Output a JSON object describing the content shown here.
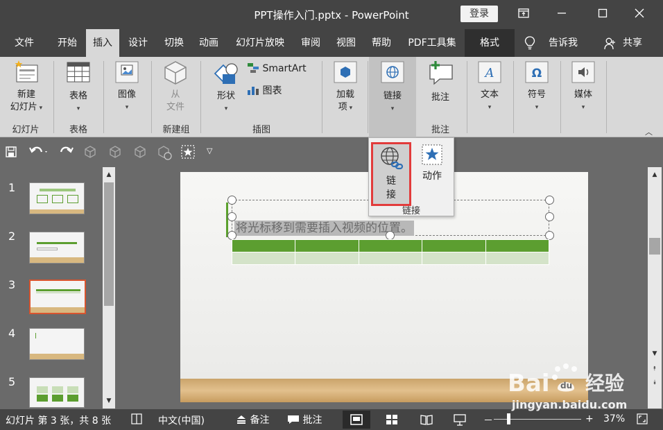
{
  "window": {
    "title": "PPT操作入门.pptx  -  PowerPoint",
    "login_label": "登录",
    "controls": [
      "ribbon-display-icon",
      "minimize-icon",
      "maximize-icon",
      "close-icon"
    ]
  },
  "tabs": [
    {
      "label": "文件"
    },
    {
      "label": "开始"
    },
    {
      "label": "插入"
    },
    {
      "label": "设计"
    },
    {
      "label": "切换"
    },
    {
      "label": "动画"
    },
    {
      "label": "幻灯片放映"
    },
    {
      "label": "审阅"
    },
    {
      "label": "视图"
    },
    {
      "label": "帮助"
    },
    {
      "label": "PDF工具集"
    },
    {
      "label": "格式"
    },
    {
      "label": "告诉我"
    },
    {
      "label": "共享"
    }
  ],
  "active_tab": "插入",
  "ribbon": {
    "new_slide": {
      "line1": "新建",
      "line2": "幻灯片"
    },
    "table": "表格",
    "image": "图像",
    "from": "从",
    "file": "文件",
    "shape": "形状",
    "smartart": "SmartArt",
    "chart": "图表",
    "addin": {
      "line1": "加载",
      "line2": "项"
    },
    "link": "链接",
    "comment": "批注",
    "text": "文本",
    "symbol": "符号",
    "media": "媒体",
    "groups": {
      "slides": "幻灯片",
      "tables": "表格",
      "new_group": "新建组",
      "illustrations": "插图",
      "comments": "批注"
    }
  },
  "link_popup": {
    "link": {
      "line1": "链",
      "line2": "接"
    },
    "action": "动作",
    "group_label": "链接"
  },
  "slides": [
    {
      "number": "1"
    },
    {
      "number": "2"
    },
    {
      "number": "3"
    },
    {
      "number": "4"
    },
    {
      "number": "5"
    }
  ],
  "current_slide": 3,
  "slide_content": {
    "text": "将光标移到需要插入视频的位置。"
  },
  "statusbar": {
    "slide_info": "幻灯片 第 3 张，共 8 张",
    "language": "中文(中国)",
    "notes": "备注",
    "comments": "批注",
    "zoom_minus": "－",
    "zoom_plus": "+",
    "zoom": "37%",
    "zoom_fraction": 0.37
  },
  "watermark": {
    "brand": "Bai",
    "brand2": "du",
    "suffix": "经验",
    "url": "jingyan.baidu.com"
  },
  "colors": {
    "accent_red": "#e23b3b",
    "theme_green": "#5c9e30",
    "titlebar": "#444444",
    "ribbon": "#d8d8d8"
  }
}
